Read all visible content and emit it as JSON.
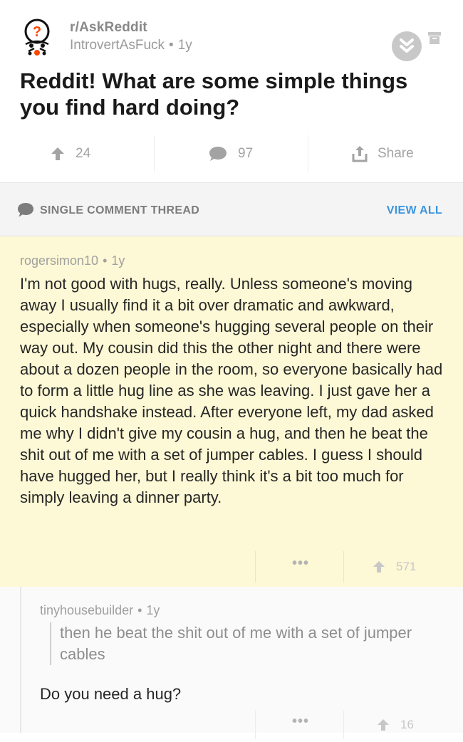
{
  "post": {
    "subreddit": "r/AskReddit",
    "author": "IntrovertAsFuck",
    "age": "1y",
    "title": "Reddit! What are some simple things you find hard doing?",
    "upvotes": "24",
    "comments": "97",
    "share_label": "Share"
  },
  "thread_bar": {
    "label": "SINGLE COMMENT THREAD",
    "view_all": "VIEW ALL"
  },
  "comments": [
    {
      "author": "rogersimon10",
      "age": "1y",
      "body": "I'm not good with hugs, really. Unless someone's moving away I usually find it a bit over dramatic and awkward, especially when someone's hugging several people on their way out. My cousin did this the other night and there were about a dozen people in the room, so everyone basically had to form a little hug line as she was leaving. I just gave her a quick handshake instead. After everyone left, my dad asked me why I didn't give my cousin a hug, and then he beat the shit out of me with a set of jumper cables. I guess I should have hugged her, but I really think it's a bit too much for simply leaving a dinner party.",
      "more": "•••",
      "score": "571"
    },
    {
      "author": "tinyhousebuilder",
      "age": "1y",
      "quote": "then he beat the shit out of me with a set of jumper cables",
      "body": "Do you need a hug?",
      "more": "•••",
      "score": "16"
    }
  ],
  "separator_dot": "•",
  "colors": {
    "highlight_bg": "#fdf8d5",
    "link_blue": "#3a94dd",
    "muted_text": "#a0a0a0"
  },
  "icons": [
    "snoo-icon",
    "collapse-icon",
    "archive-icon",
    "upvote-icon",
    "comment-icon",
    "share-icon",
    "thread-icon"
  ]
}
